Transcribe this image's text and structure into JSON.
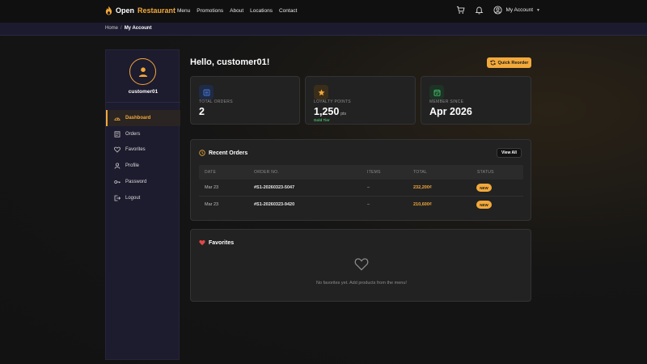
{
  "brand": {
    "word1": "Open",
    "word2": "Restaurant",
    "accent": "#f2a93b"
  },
  "nav": {
    "links": [
      "Menu",
      "Promotions",
      "About",
      "Locations",
      "Contact"
    ],
    "account_label": "My Account",
    "icons": [
      "cart-icon",
      "bell-icon",
      "user-circle-icon",
      "chevron-down-icon"
    ]
  },
  "breadcrumb": {
    "home": "Home",
    "separator": "/",
    "current": "My Account"
  },
  "sidebar": {
    "username": "customer01",
    "items": [
      {
        "label": "Dashboard",
        "icon": "dashboard-icon",
        "active": true
      },
      {
        "label": "Orders",
        "icon": "receipt-icon",
        "active": false
      },
      {
        "label": "Favorites",
        "icon": "heart-icon",
        "active": false
      },
      {
        "label": "Profile",
        "icon": "user-icon",
        "active": false
      },
      {
        "label": "Password",
        "icon": "key-icon",
        "active": false
      },
      {
        "label": "Logout",
        "icon": "logout-icon",
        "active": false
      }
    ]
  },
  "main": {
    "greeting": "Hello, customer01!",
    "quick_reorder": "Quick Reorder",
    "stats": [
      {
        "label": "TOTAL ORDERS",
        "value": "2",
        "icon": "list-icon",
        "color": "#4a7be0"
      },
      {
        "label": "LOYALTY POINTS",
        "value": "1,250",
        "unit": "pts",
        "tier": "Gold Tier",
        "icon": "star-icon",
        "color": "#f2a93b"
      },
      {
        "label": "MEMBER SINCE",
        "value": "Apr 2026",
        "icon": "calendar-icon",
        "color": "#46c36b"
      }
    ]
  },
  "recent_orders": {
    "title": "Recent Orders",
    "view_all": "View All",
    "columns": [
      "DATE",
      "ORDER NO.",
      "ITEMS",
      "TOTAL",
      "STATUS"
    ],
    "rows": [
      {
        "date": "Mar 23",
        "order_no": "#S1-20260323-5047",
        "items": "–",
        "total": "232,200₫",
        "status": "NEW"
      },
      {
        "date": "Mar 23",
        "order_no": "#S1-20260323-9420",
        "items": "–",
        "total": "210,600₫",
        "status": "NEW"
      }
    ]
  },
  "favorites": {
    "title": "Favorites",
    "empty_text": "No favorites yet. Add products from the menu!"
  }
}
